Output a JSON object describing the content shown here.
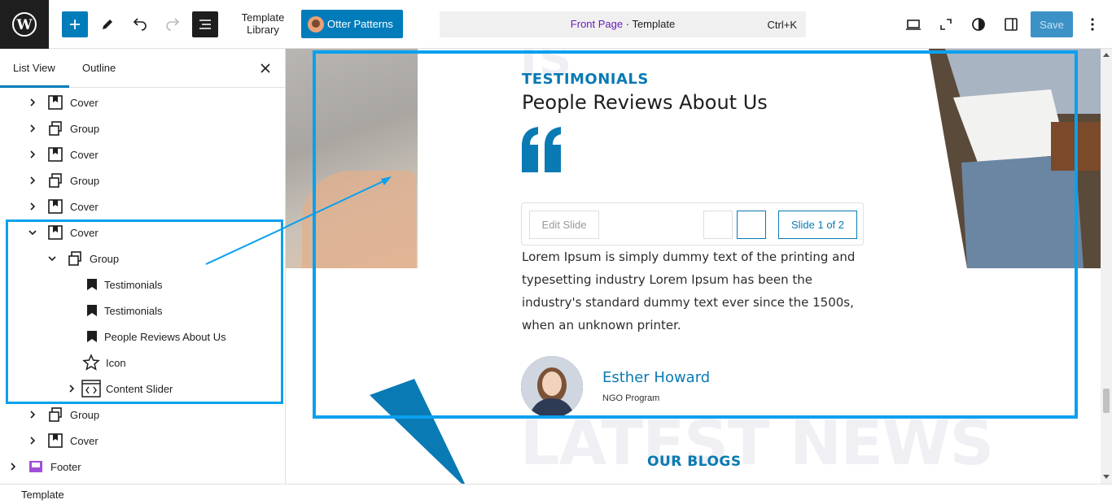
{
  "topbar": {
    "template_library": "Template\nLibrary",
    "otter_label": "Otter Patterns",
    "command": {
      "page": "Front Page",
      "separator": " · ",
      "type": "Template",
      "shortcut": "Ctrl+K"
    },
    "save_label": "Save"
  },
  "sidebar": {
    "tabs": [
      {
        "label": "List View",
        "active": true
      },
      {
        "label": "Outline",
        "active": false
      }
    ],
    "tree": [
      {
        "label": "Cover",
        "icon": "cover-icon",
        "expanded": false
      },
      {
        "label": "Group",
        "icon": "group-icon",
        "expanded": false
      },
      {
        "label": "Cover",
        "icon": "cover-icon",
        "expanded": false
      },
      {
        "label": "Group",
        "icon": "group-icon",
        "expanded": false
      },
      {
        "label": "Cover",
        "icon": "cover-icon",
        "expanded": false
      },
      {
        "label": "Cover",
        "icon": "cover-icon",
        "expanded": true
      },
      {
        "label": "Group",
        "icon": "group-icon",
        "expanded": true
      },
      {
        "label": "Testimonials",
        "icon": "bookmark-icon"
      },
      {
        "label": "Testimonials",
        "icon": "bookmark-icon"
      },
      {
        "label": "People Reviews About Us",
        "icon": "bookmark-icon"
      },
      {
        "label": "Icon",
        "icon": "star-icon"
      },
      {
        "label": "Content Slider",
        "icon": "slider-icon",
        "expanded": false
      },
      {
        "label": "Group",
        "icon": "group-icon",
        "expanded": false
      },
      {
        "label": "Cover",
        "icon": "cover-icon",
        "expanded": false
      },
      {
        "label": "Footer",
        "icon": "footer-icon",
        "expanded": false
      }
    ]
  },
  "status_bar": {
    "label": "Template"
  },
  "canvas": {
    "ghost_top": "IS",
    "section_label": "TESTIMONIALS",
    "heading": "People Reviews About Us",
    "slider": {
      "edit_label": "Edit Slide",
      "count": "Slide 1 of 2"
    },
    "body": "Lorem Ipsum is simply dummy text of the printing and typesetting industry Lorem Ipsum  has  been the industry's standard dummy text ever since the 1500s, when an unknown printer.",
    "person": {
      "name": "Esther Howard",
      "role": "NGO Program"
    },
    "ghost_bottom": "LATEST NEWS",
    "blogs_label": "OUR BLOGS"
  },
  "colors": {
    "accent": "#007cba",
    "brand_blue": "#0a7ab4",
    "highlight": "#0aa0ee",
    "command_page": "#6a1fb6"
  }
}
